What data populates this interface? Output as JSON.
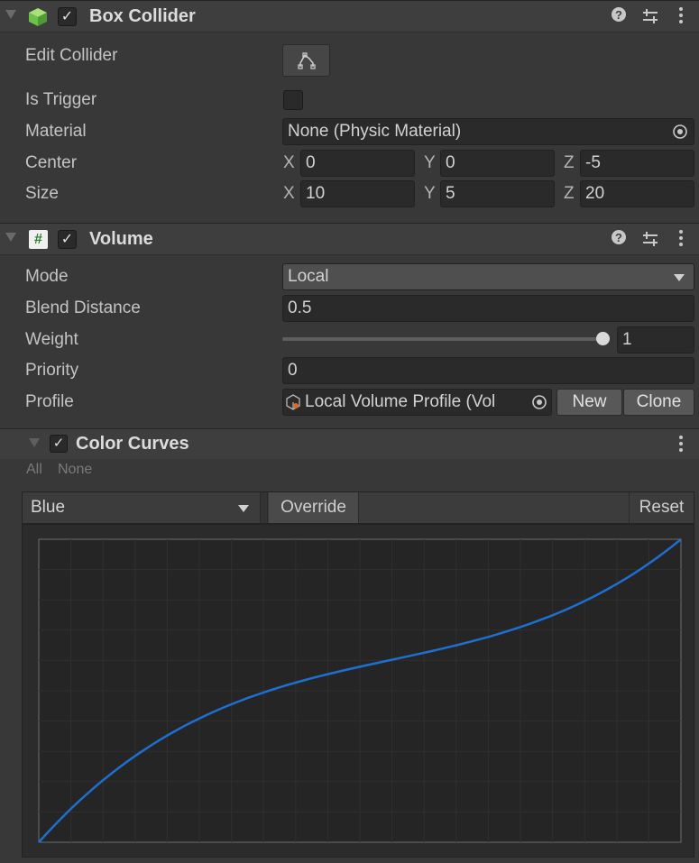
{
  "box_collider": {
    "title": "Box Collider",
    "enabled": true,
    "edit_collider_label": "Edit Collider",
    "is_trigger_label": "Is Trigger",
    "is_trigger_checked": false,
    "material_label": "Material",
    "material_value": "None (Physic Material)",
    "center_label": "Center",
    "center": {
      "x": "0",
      "y": "0",
      "z": "-5"
    },
    "size_label": "Size",
    "size": {
      "x": "10",
      "y": "5",
      "z": "20"
    },
    "icons": [
      "box-collider-icon",
      "help-icon",
      "presets-icon",
      "menu-icon"
    ]
  },
  "volume": {
    "title": "Volume",
    "enabled": true,
    "mode_label": "Mode",
    "mode_value": "Local",
    "blend_distance_label": "Blend Distance",
    "blend_distance_value": "0.5",
    "weight_label": "Weight",
    "weight_value": "1",
    "weight_fraction": 1.0,
    "priority_label": "Priority",
    "priority_value": "0",
    "profile_label": "Profile",
    "profile_value": "Local Volume Profile (Vol",
    "new_label": "New",
    "clone_label": "Clone"
  },
  "color_curves": {
    "title": "Color Curves",
    "enabled": true,
    "all_label": "All",
    "none_label": "None",
    "channel_value": "Blue",
    "override_label": "Override",
    "reset_label": "Reset",
    "curve_color": "#1e6fd0"
  },
  "axis_letters": {
    "x": "X",
    "y": "Y",
    "z": "Z"
  },
  "colors": {
    "background": "#383838",
    "field": "#2a2a2a",
    "accent_green": "#7ed35a"
  }
}
